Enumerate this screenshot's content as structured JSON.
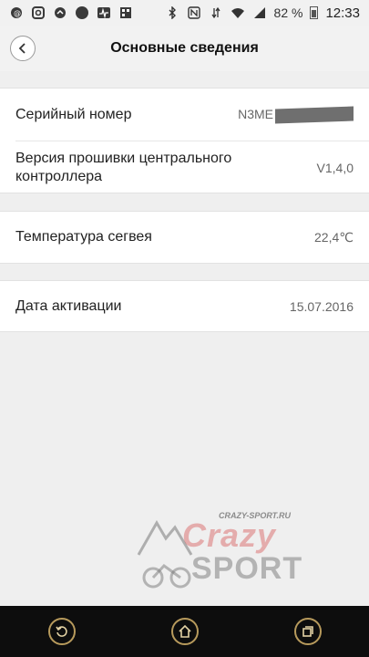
{
  "status_bar": {
    "icons_left": [
      "notification-icon",
      "instagram-icon",
      "app-icon",
      "circle-icon",
      "activity-icon",
      "image-icon"
    ],
    "icons_right": [
      "bluetooth-icon",
      "nfc-icon",
      "data-icon",
      "wifi-icon",
      "signal-icon",
      "battery-icon"
    ],
    "battery_percent": "82 %",
    "time": "12:33"
  },
  "header": {
    "title": "Основные сведения"
  },
  "info": {
    "serial_label": "Серийный номер",
    "serial_value": "N3ME",
    "firmware_label": "Версия прошивки центрального контроллера",
    "firmware_value": "V1,4,0",
    "temperature_label": "Температура сегвея",
    "temperature_value": "22,4℃",
    "activation_label": "Дата активации",
    "activation_value": "15.07.2016"
  },
  "watermark": {
    "site": "CRAZY-SPORT.RU",
    "brand_top": "Crazy",
    "brand_bottom": "SPORT"
  },
  "navbar": {
    "buttons": [
      "back-nav-icon",
      "home-icon",
      "recent-apps-icon"
    ]
  }
}
